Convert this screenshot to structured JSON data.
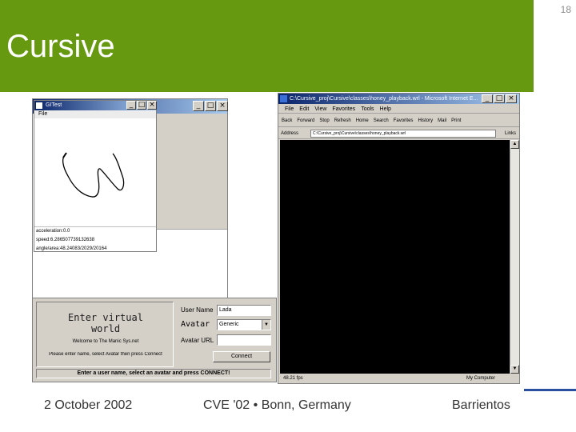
{
  "slide": {
    "number": "18",
    "title": "Cursive",
    "footer_left": "2 October 2002",
    "footer_center": "CVE '02  •  Bonn, Germany",
    "footer_right": "Barrientos",
    "colors": {
      "title_band": "#66990f",
      "rule": "#2a4fa0"
    }
  },
  "git_window": {
    "title": "GITest",
    "menu": "File",
    "info_lines": [
      "acceleration:0.0",
      "speed:6.286507739132638",
      "angle/area:48.24083/2029/20164"
    ]
  },
  "control_panel": {
    "heading_line1": "Enter virtual",
    "heading_line2": "world",
    "welcome": "Welcome to The Manic Sys.net",
    "instruction": "Please enter name, select Avatar then press Connect",
    "username_label": "User Name",
    "username_value": "Lada",
    "avatar_label": "Avatar",
    "avatar_value": "Generic",
    "avatar_url_label": "Avatar URL",
    "avatar_url_value": "",
    "connect_label": "Connect",
    "status": "Enter a user name, select an avatar and press CONNECT!"
  },
  "browser": {
    "title": "C:\\Cursive_proj\\Cursive\\classes\\honey_playback.wrl - Microsoft Internet E...",
    "menu": [
      "File",
      "Edit",
      "View",
      "Favorites",
      "Tools",
      "Help"
    ],
    "toolbar": [
      "Back",
      "Forward",
      "Stop",
      "Refresh",
      "Home",
      "Search",
      "Favorites",
      "History",
      "Mail",
      "Print"
    ],
    "address_label": "Address",
    "address": "C:\\Cursive_proj\\Cursive\\classes\\honey_playback.wrl",
    "go_label": "Links",
    "status_left": "48.21 fps",
    "status_right": "My Computer"
  }
}
